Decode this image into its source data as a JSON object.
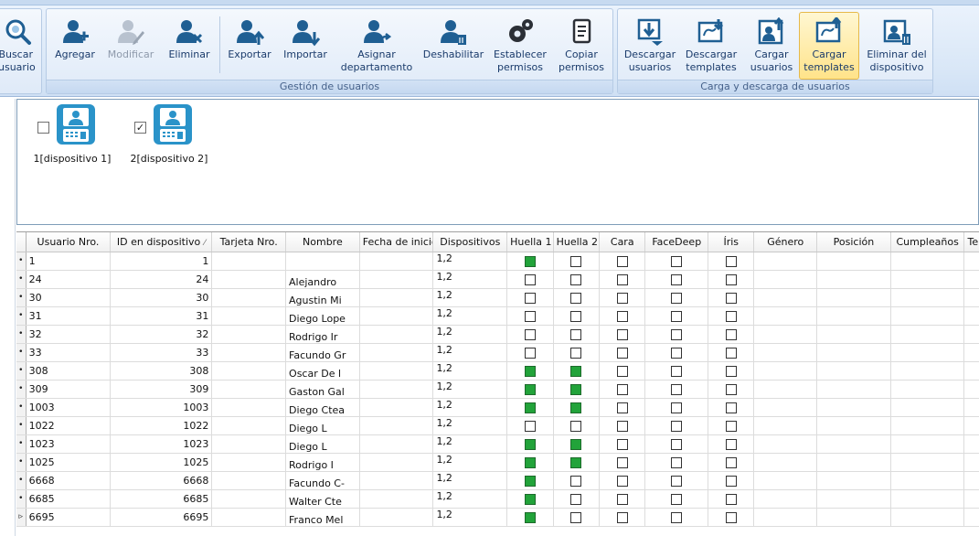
{
  "ribbon": {
    "buttons": {
      "buscar": "Buscar\nusuario",
      "agregar": "Agregar",
      "modificar": "Modificar",
      "eliminar": "Eliminar",
      "exportar": "Exportar",
      "importar": "Importar",
      "asignar": "Asignar\ndepartamento",
      "deshabilitar": "Deshabilitar",
      "establecer": "Establecer\npermisos",
      "copiar": "Copiar\npermisos",
      "descargar_usuarios": "Descargar\nusuarios",
      "descargar_templates": "Descargar\ntemplates",
      "cargar_usuarios": "Cargar\nusuarios",
      "cargar_templates": "Cargar\ntemplates",
      "eliminar_dispositivo": "Eliminar del\ndispositivo"
    },
    "group_gestion": "Gestión de usuarios",
    "group_carga": "Carga y descarga de usuarios"
  },
  "devices": [
    {
      "label": "1[dispositivo 1]",
      "checked": false
    },
    {
      "label": "2[dispositivo 2]",
      "checked": true
    }
  ],
  "table": {
    "columns": [
      "Usuario Nro.",
      "ID en dispositivo",
      "Tarjeta Nro.",
      "Nombre",
      "Fecha de inicio",
      "Dispositivos",
      "Huella 1",
      "Huella 2",
      "Cara",
      "FaceDeep",
      "Íris",
      "Género",
      "Posición",
      "Cumpleaños",
      "Tel"
    ],
    "sort_indicator": "⁄",
    "rows": [
      {
        "usuario": "1",
        "id": "1",
        "nombre": "",
        "dispositivos": "1,2",
        "h1": true,
        "h2": false
      },
      {
        "usuario": "24",
        "id": "24",
        "nombre": "Alejandro",
        "dispositivos": "1,2",
        "h1": false,
        "h2": false
      },
      {
        "usuario": "30",
        "id": "30",
        "nombre": "Agustin Mi",
        "dispositivos": "1,2",
        "h1": false,
        "h2": false
      },
      {
        "usuario": "31",
        "id": "31",
        "nombre": "Diego Lope",
        "dispositivos": "1,2",
        "h1": false,
        "h2": false
      },
      {
        "usuario": "32",
        "id": "32",
        "nombre": "Rodrigo Ir",
        "dispositivos": "1,2",
        "h1": false,
        "h2": false
      },
      {
        "usuario": "33",
        "id": "33",
        "nombre": "Facundo Gr",
        "dispositivos": "1,2",
        "h1": false,
        "h2": false
      },
      {
        "usuario": "308",
        "id": "308",
        "nombre": "Oscar De l",
        "dispositivos": "1,2",
        "h1": true,
        "h2": true
      },
      {
        "usuario": "309",
        "id": "309",
        "nombre": "Gaston Gal",
        "dispositivos": "1,2",
        "h1": true,
        "h2": true
      },
      {
        "usuario": "1003",
        "id": "1003",
        "nombre": "Diego Ctea",
        "dispositivos": "1,2",
        "h1": true,
        "h2": true
      },
      {
        "usuario": "1022",
        "id": "1022",
        "nombre": "Diego L",
        "dispositivos": "1,2",
        "h1": false,
        "h2": false
      },
      {
        "usuario": "1023",
        "id": "1023",
        "nombre": "Diego L",
        "dispositivos": "1,2",
        "h1": true,
        "h2": true
      },
      {
        "usuario": "1025",
        "id": "1025",
        "nombre": "Rodrigo I",
        "dispositivos": "1,2",
        "h1": true,
        "h2": true
      },
      {
        "usuario": "6668",
        "id": "6668",
        "nombre": "Facundo C-",
        "dispositivos": "1,2",
        "h1": true,
        "h2": false
      },
      {
        "usuario": "6685",
        "id": "6685",
        "nombre": "Walter Cte",
        "dispositivos": "1,2",
        "h1": true,
        "h2": false
      },
      {
        "usuario": "6695",
        "id": "6695",
        "nombre": "Franco Mel",
        "dispositivos": "1,2",
        "h1": true,
        "h2": false
      }
    ],
    "row_indicator": "•",
    "current_row_indicator": "▹"
  },
  "colors": {
    "accent": "#1f6fa8",
    "fingerprint_on": "#22a33a",
    "active_button": "#ffe38a"
  }
}
